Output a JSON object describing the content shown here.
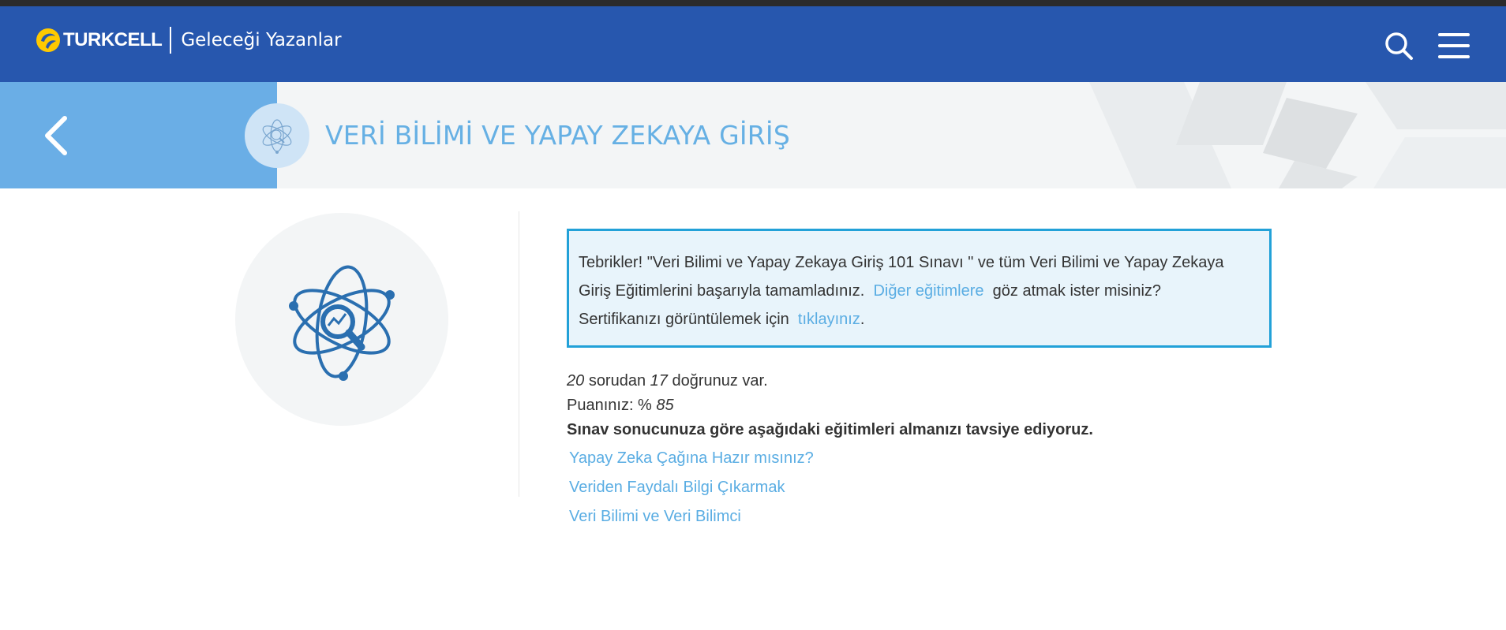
{
  "header": {
    "brand": "TURKCELL",
    "subtitle": "Geleceği Yazanlar",
    "search_icon": "search-icon",
    "menu_icon": "hamburger-menu-icon",
    "brand_color": "#2757ae",
    "logo_color": "#ffc900"
  },
  "banner": {
    "back_icon": "chevron-left-icon",
    "course_icon": "atom-analytics-icon",
    "title": "VERİ BİLİMİ VE YAPAY ZEKAYA GİRİŞ",
    "accent_color": "#6aaee6"
  },
  "course_image": {
    "icon": "atom-analytics-icon",
    "color": "#2a6fb0"
  },
  "notice": {
    "text_1": "Tebrikler! \"Veri Bilimi ve Yapay Zekaya Giriş 101 Sınavı \" ve tüm Veri Bilimi ve Yapay Zekaya Giriş Eğitimlerini başarıyla tamamladınız.",
    "link_other": "Diğer eğitimlere",
    "text_2": "göz atmak ister misiniz?",
    "text_3": "Sertifikanızı görüntülemek için",
    "link_certificate": "tıklayınız",
    "text_4": ".",
    "border_color": "#22a1d8",
    "link_color": "#5aade3"
  },
  "results": {
    "total_questions": "20",
    "questions_text": "sorudan",
    "correct_answers": "17",
    "correct_text": "doğrunuz var.",
    "score_label": "Puanınız: %",
    "score_value": "85",
    "recommendation": "Sınav sonucunuza göre aşağıdaki eğitimleri almanızı tavsiye ediyoruz."
  },
  "recommended_courses": [
    "Yapay Zeka Çağına Hazır mısınız?",
    "Veriden Faydalı Bilgi Çıkarmak",
    "Veri Bilimi ve Veri Bilimci"
  ]
}
